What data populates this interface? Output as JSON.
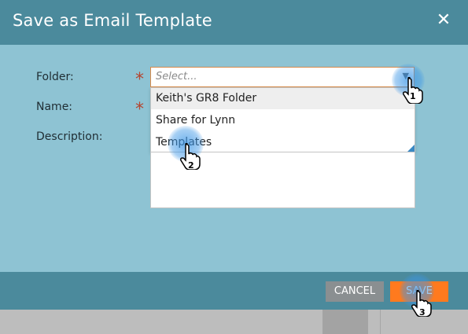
{
  "dialog": {
    "title": "Save as Email Template",
    "close_icon": "close-icon"
  },
  "form": {
    "folder_label": "Folder:",
    "name_label": "Name:",
    "description_label": "Description:",
    "required_marker": "*",
    "folder_placeholder": "Select...",
    "folder_options": [
      "Keith's GR8 Folder",
      "Share for Lynn",
      "Templates"
    ]
  },
  "footer": {
    "cancel_label": "CANCEL",
    "save_label": "SAVE"
  },
  "annotations": {
    "step1": "1",
    "step2": "2",
    "step3": "3"
  },
  "colors": {
    "titlebar": "#4b8a9c",
    "body": "#8ec3d3",
    "save_button": "#ff7a1e",
    "cancel_button": "#8a8f91",
    "required": "#b5442e"
  }
}
